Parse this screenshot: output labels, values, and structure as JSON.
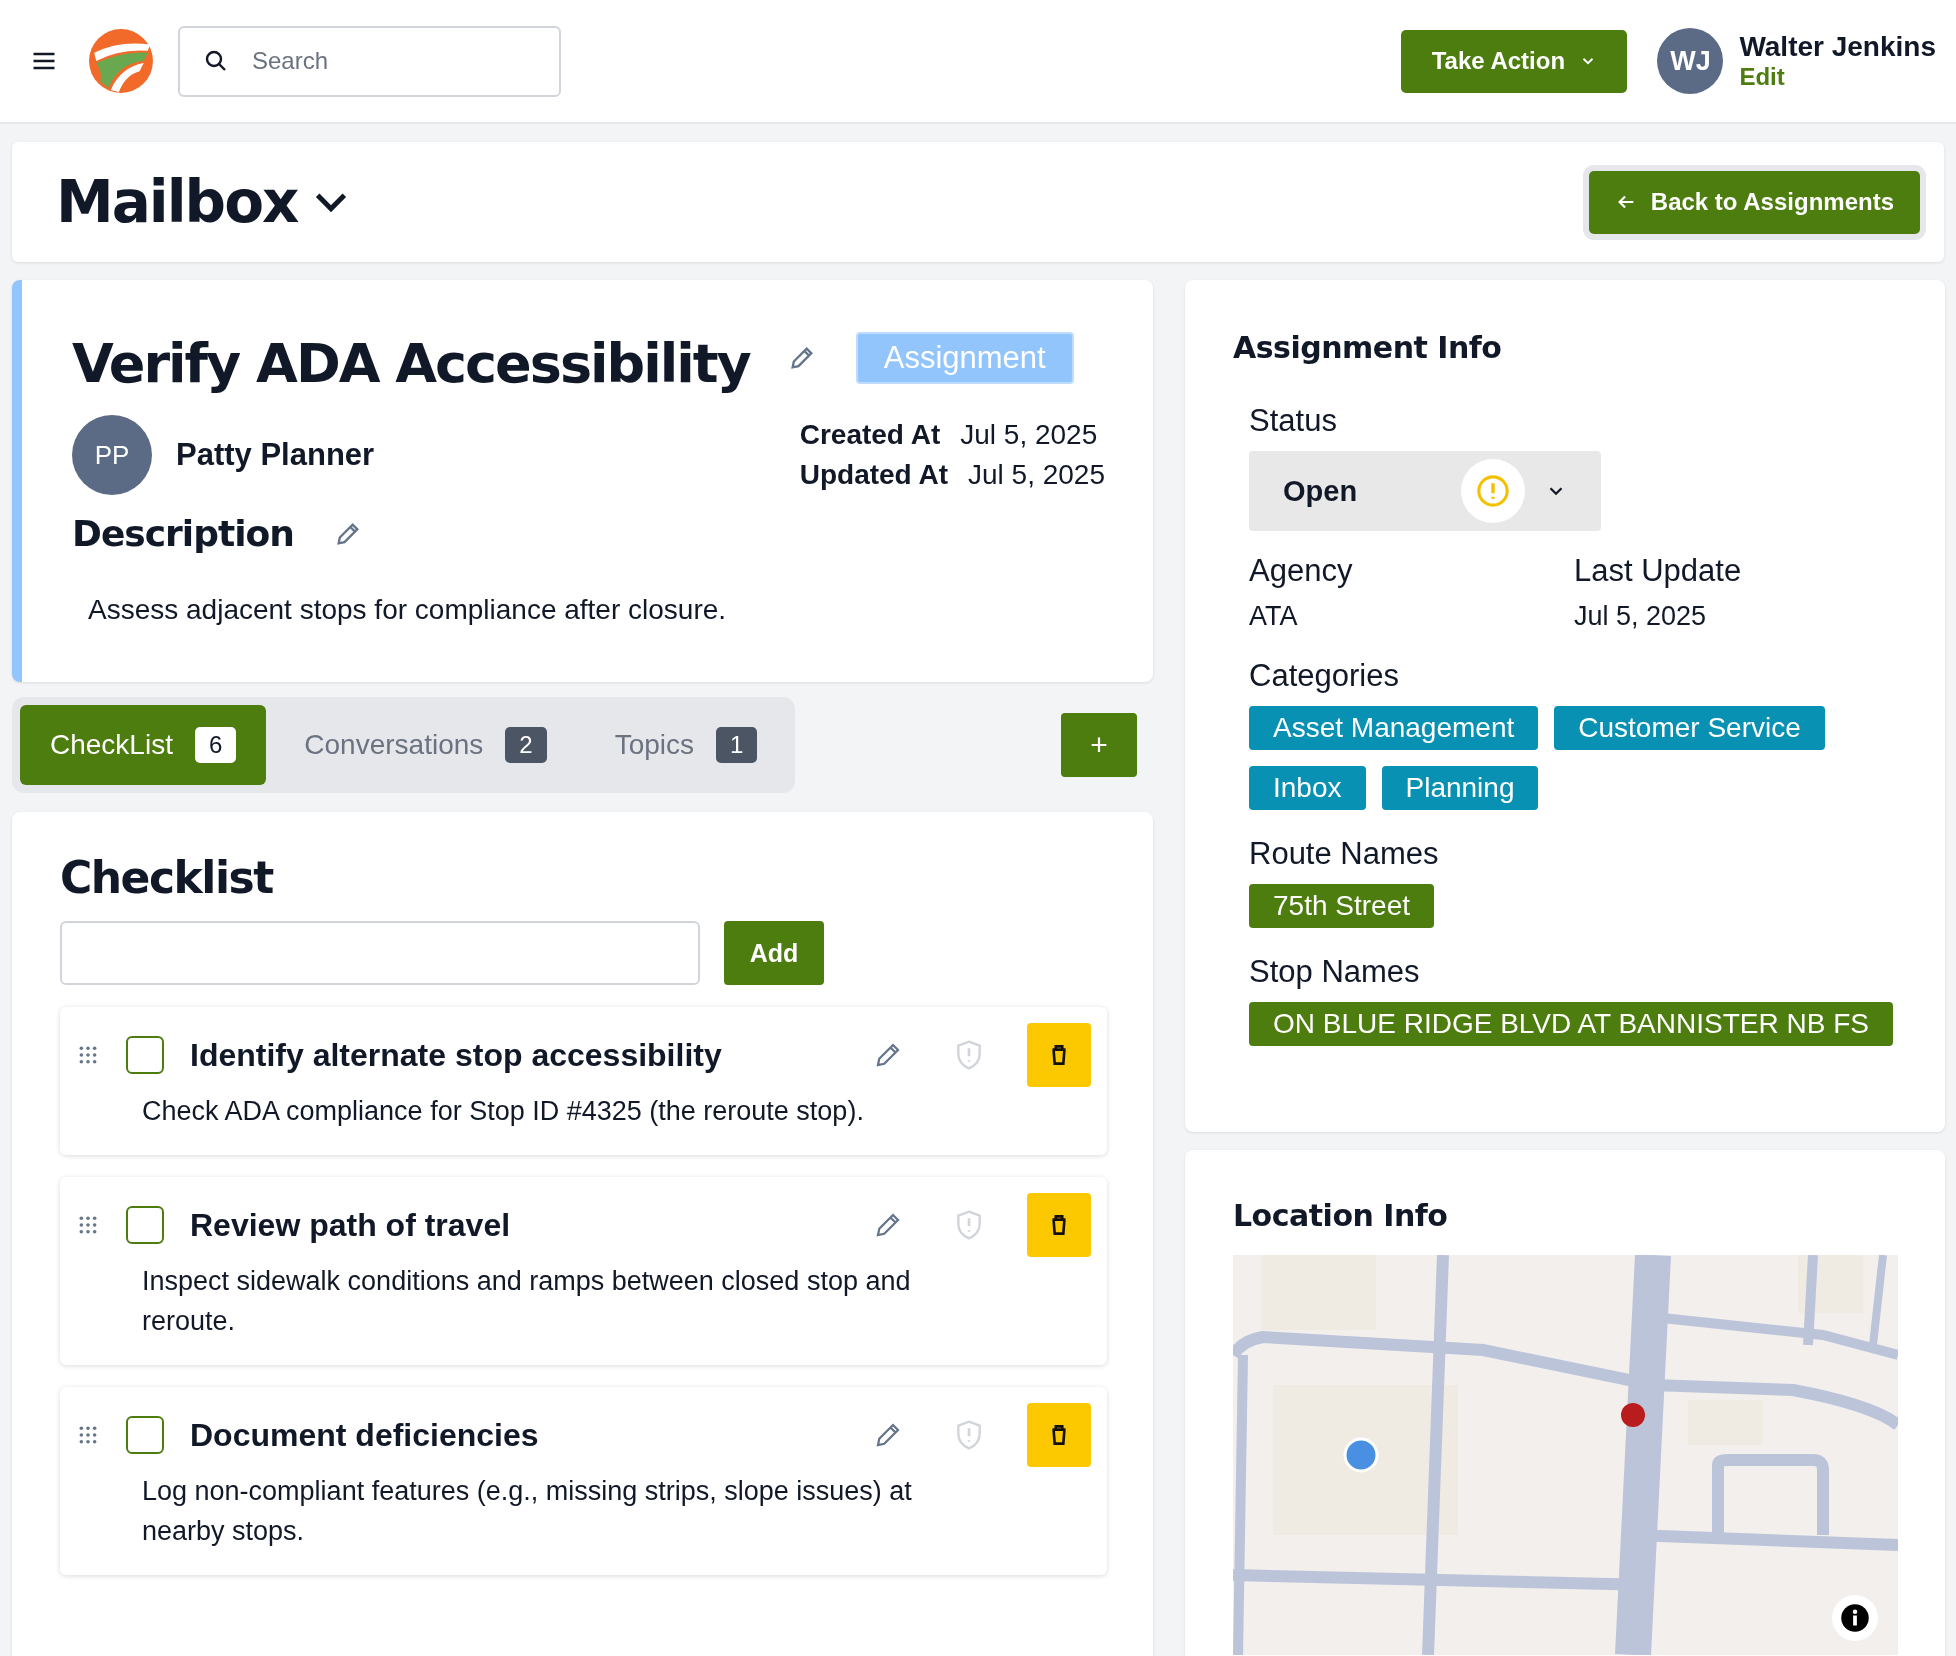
{
  "header": {
    "search": {
      "placeholder": "Search"
    },
    "action_button": "Take Action",
    "user": {
      "initials": "WJ",
      "name": "Walter Jenkins",
      "edit_link": "Edit"
    }
  },
  "page_title": "Mailbox",
  "back_button": "Back to Assignments",
  "assignment": {
    "title": "Verify ADA Accessibility",
    "type_badge": "Assignment",
    "author": {
      "initials": "PP",
      "name": "Patty Planner"
    },
    "dates": [
      {
        "label": "Created At",
        "value": "Jul 5, 2025"
      },
      {
        "label": "Updated At",
        "value": "Jul 5, 2025"
      }
    ],
    "description_heading": "Description",
    "description": "Assess adjacent stops for compliance after closure."
  },
  "tabs": [
    {
      "label": "CheckList",
      "count": "6",
      "selected": true
    },
    {
      "label": "Conversations",
      "count": "2",
      "selected": false
    },
    {
      "label": "Topics",
      "count": "1",
      "selected": false
    }
  ],
  "add_tab_button": "+",
  "checklist": {
    "heading": "Checklist",
    "add_button": "Add",
    "items": [
      {
        "title": "Identify alternate stop accessibility",
        "description": "Check ADA compliance for Stop ID #4325 (the reroute stop).",
        "checked": false
      },
      {
        "title": "Review path of travel",
        "description": "Inspect sidewalk conditions and ramps between closed stop and reroute.",
        "checked": false
      },
      {
        "title": "Document deficiencies",
        "description": "Log non-compliant features (e.g., missing strips, slope issues) at nearby stops.",
        "checked": false
      }
    ]
  },
  "info": {
    "heading": "Assignment Info",
    "status_label": "Status",
    "status": "Open",
    "fields": [
      {
        "label": "Agency",
        "value": "ATA"
      },
      {
        "label": "Last Update",
        "value": "Jul 5, 2025"
      }
    ],
    "tag_groups": [
      {
        "label": "Categories",
        "kind": "category",
        "tags": [
          "Asset Management",
          "Customer Service",
          "Inbox",
          "Planning"
        ]
      },
      {
        "label": "Route Names",
        "kind": "route",
        "tags": [
          "75th Street"
        ]
      },
      {
        "label": "Stop Names",
        "kind": "stop",
        "tags": [
          "ON BLUE RIDGE BLVD AT BANNISTER NB FS"
        ]
      }
    ]
  },
  "location": {
    "heading": "Location Info"
  }
}
